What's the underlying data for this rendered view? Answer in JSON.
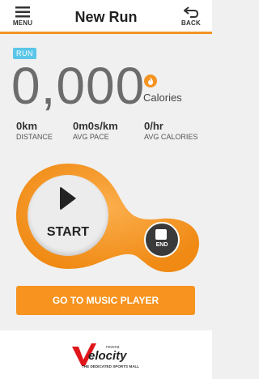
{
  "header": {
    "title": "New Run",
    "menu_label": "MENU",
    "back_label": "BACK"
  },
  "run_badge": "RUN",
  "calories": {
    "value": "0,000",
    "label": "Calories"
  },
  "stats": [
    {
      "value": "0km",
      "label": "DISTANCE"
    },
    {
      "value": "0m0s/km",
      "label": "AVG PACE"
    },
    {
      "value": "0/hr",
      "label": "AVG CALORIES"
    }
  ],
  "controls": {
    "start_label": "START",
    "end_label": "END"
  },
  "music_button_label": "GO TO MUSIC PLAYER",
  "footer": {
    "brand_prefix": "novena",
    "brand_name": "velocity",
    "brand_tagline": "THE DEDICATED SPORTS MALL"
  },
  "colors": {
    "accent": "#f39322",
    "badge": "#5bc6e8",
    "end_button": "#3a3a3a"
  }
}
